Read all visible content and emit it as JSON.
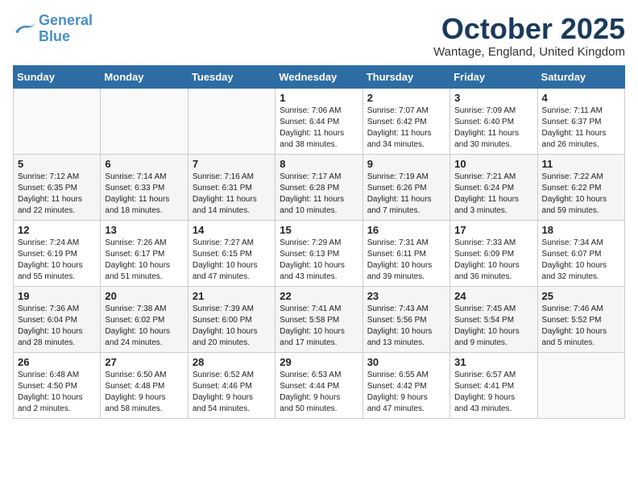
{
  "logo": {
    "line1": "General",
    "line2": "Blue"
  },
  "title": "October 2025",
  "location": "Wantage, England, United Kingdom",
  "weekdays": [
    "Sunday",
    "Monday",
    "Tuesday",
    "Wednesday",
    "Thursday",
    "Friday",
    "Saturday"
  ],
  "weeks": [
    [
      {
        "day": "",
        "info": ""
      },
      {
        "day": "",
        "info": ""
      },
      {
        "day": "",
        "info": ""
      },
      {
        "day": "1",
        "info": "Sunrise: 7:06 AM\nSunset: 6:44 PM\nDaylight: 11 hours\nand 38 minutes."
      },
      {
        "day": "2",
        "info": "Sunrise: 7:07 AM\nSunset: 6:42 PM\nDaylight: 11 hours\nand 34 minutes."
      },
      {
        "day": "3",
        "info": "Sunrise: 7:09 AM\nSunset: 6:40 PM\nDaylight: 11 hours\nand 30 minutes."
      },
      {
        "day": "4",
        "info": "Sunrise: 7:11 AM\nSunset: 6:37 PM\nDaylight: 11 hours\nand 26 minutes."
      }
    ],
    [
      {
        "day": "5",
        "info": "Sunrise: 7:12 AM\nSunset: 6:35 PM\nDaylight: 11 hours\nand 22 minutes."
      },
      {
        "day": "6",
        "info": "Sunrise: 7:14 AM\nSunset: 6:33 PM\nDaylight: 11 hours\nand 18 minutes."
      },
      {
        "day": "7",
        "info": "Sunrise: 7:16 AM\nSunset: 6:31 PM\nDaylight: 11 hours\nand 14 minutes."
      },
      {
        "day": "8",
        "info": "Sunrise: 7:17 AM\nSunset: 6:28 PM\nDaylight: 11 hours\nand 10 minutes."
      },
      {
        "day": "9",
        "info": "Sunrise: 7:19 AM\nSunset: 6:26 PM\nDaylight: 11 hours\nand 7 minutes."
      },
      {
        "day": "10",
        "info": "Sunrise: 7:21 AM\nSunset: 6:24 PM\nDaylight: 11 hours\nand 3 minutes."
      },
      {
        "day": "11",
        "info": "Sunrise: 7:22 AM\nSunset: 6:22 PM\nDaylight: 10 hours\nand 59 minutes."
      }
    ],
    [
      {
        "day": "12",
        "info": "Sunrise: 7:24 AM\nSunset: 6:19 PM\nDaylight: 10 hours\nand 55 minutes."
      },
      {
        "day": "13",
        "info": "Sunrise: 7:26 AM\nSunset: 6:17 PM\nDaylight: 10 hours\nand 51 minutes."
      },
      {
        "day": "14",
        "info": "Sunrise: 7:27 AM\nSunset: 6:15 PM\nDaylight: 10 hours\nand 47 minutes."
      },
      {
        "day": "15",
        "info": "Sunrise: 7:29 AM\nSunset: 6:13 PM\nDaylight: 10 hours\nand 43 minutes."
      },
      {
        "day": "16",
        "info": "Sunrise: 7:31 AM\nSunset: 6:11 PM\nDaylight: 10 hours\nand 39 minutes."
      },
      {
        "day": "17",
        "info": "Sunrise: 7:33 AM\nSunset: 6:09 PM\nDaylight: 10 hours\nand 36 minutes."
      },
      {
        "day": "18",
        "info": "Sunrise: 7:34 AM\nSunset: 6:07 PM\nDaylight: 10 hours\nand 32 minutes."
      }
    ],
    [
      {
        "day": "19",
        "info": "Sunrise: 7:36 AM\nSunset: 6:04 PM\nDaylight: 10 hours\nand 28 minutes."
      },
      {
        "day": "20",
        "info": "Sunrise: 7:38 AM\nSunset: 6:02 PM\nDaylight: 10 hours\nand 24 minutes."
      },
      {
        "day": "21",
        "info": "Sunrise: 7:39 AM\nSunset: 6:00 PM\nDaylight: 10 hours\nand 20 minutes."
      },
      {
        "day": "22",
        "info": "Sunrise: 7:41 AM\nSunset: 5:58 PM\nDaylight: 10 hours\nand 17 minutes."
      },
      {
        "day": "23",
        "info": "Sunrise: 7:43 AM\nSunset: 5:56 PM\nDaylight: 10 hours\nand 13 minutes."
      },
      {
        "day": "24",
        "info": "Sunrise: 7:45 AM\nSunset: 5:54 PM\nDaylight: 10 hours\nand 9 minutes."
      },
      {
        "day": "25",
        "info": "Sunrise: 7:46 AM\nSunset: 5:52 PM\nDaylight: 10 hours\nand 5 minutes."
      }
    ],
    [
      {
        "day": "26",
        "info": "Sunrise: 6:48 AM\nSunset: 4:50 PM\nDaylight: 10 hours\nand 2 minutes."
      },
      {
        "day": "27",
        "info": "Sunrise: 6:50 AM\nSunset: 4:48 PM\nDaylight: 9 hours\nand 58 minutes."
      },
      {
        "day": "28",
        "info": "Sunrise: 6:52 AM\nSunset: 4:46 PM\nDaylight: 9 hours\nand 54 minutes."
      },
      {
        "day": "29",
        "info": "Sunrise: 6:53 AM\nSunset: 4:44 PM\nDaylight: 9 hours\nand 50 minutes."
      },
      {
        "day": "30",
        "info": "Sunrise: 6:55 AM\nSunset: 4:42 PM\nDaylight: 9 hours\nand 47 minutes."
      },
      {
        "day": "31",
        "info": "Sunrise: 6:57 AM\nSunset: 4:41 PM\nDaylight: 9 hours\nand 43 minutes."
      },
      {
        "day": "",
        "info": ""
      }
    ]
  ]
}
